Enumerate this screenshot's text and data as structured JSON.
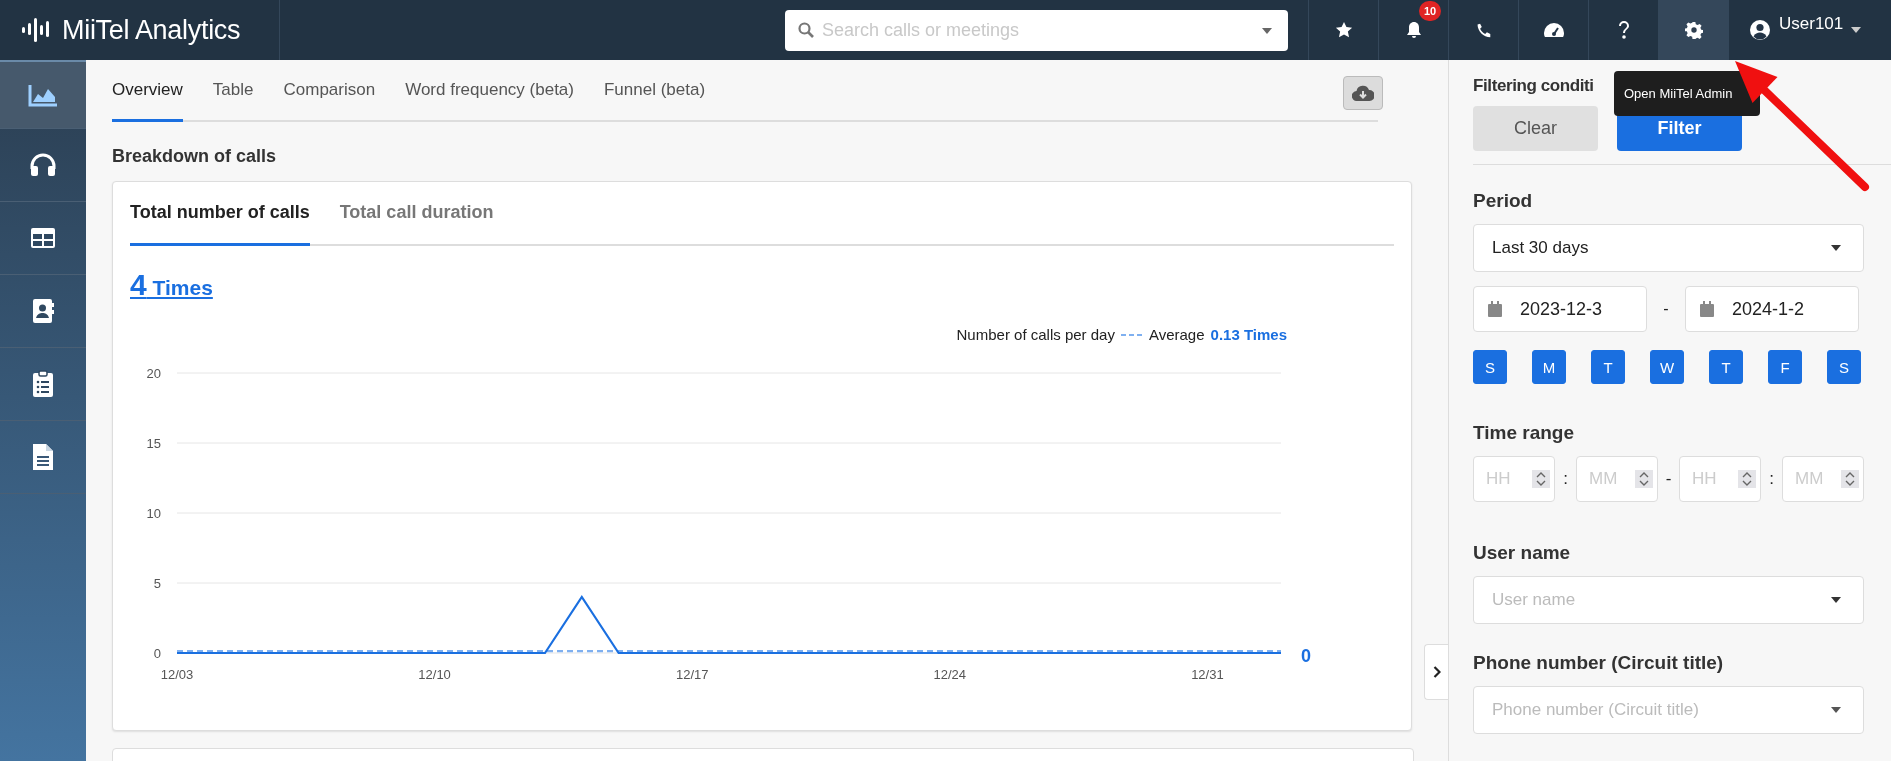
{
  "app": {
    "title": "MiiTel Analytics"
  },
  "search": {
    "placeholder": "Search calls or meetings"
  },
  "toolbar": [
    {
      "kind": "star",
      "selected": false
    },
    {
      "kind": "bell",
      "selected": false,
      "badge": "10"
    },
    {
      "kind": "phone",
      "selected": false
    },
    {
      "kind": "gauge",
      "selected": false
    },
    {
      "kind": "help",
      "selected": false
    },
    {
      "kind": "settings",
      "selected": true
    }
  ],
  "user": {
    "name": "User101"
  },
  "tooltip": {
    "text": "Open MiiTel Admin"
  },
  "sidebar": {
    "items": [
      {
        "kind": "chart",
        "selected": true
      },
      {
        "kind": "headphones",
        "selected": false
      },
      {
        "kind": "table",
        "selected": false
      },
      {
        "kind": "contacts",
        "selected": false
      },
      {
        "kind": "clipboard",
        "selected": false
      },
      {
        "kind": "document",
        "selected": false
      }
    ]
  },
  "tabs": [
    {
      "label": "Overview",
      "selected": true
    },
    {
      "label": "Table",
      "selected": false
    },
    {
      "label": "Comparison",
      "selected": false
    },
    {
      "label": "Word frequency (beta)",
      "selected": false
    },
    {
      "label": "Funnel (beta)",
      "selected": false
    }
  ],
  "section_title": "Breakdown of calls",
  "card": {
    "tabs": [
      {
        "label": "Total number of calls",
        "selected": true
      },
      {
        "label": "Total call duration",
        "selected": false
      }
    ],
    "total": {
      "number": "4",
      "unit": "Times"
    },
    "legend": {
      "average_value": "0.13 Times"
    },
    "end_label": "0",
    "chart_data": {
      "type": "line",
      "categories": [
        "12/03",
        null,
        null,
        null,
        null,
        null,
        null,
        "12/10",
        null,
        null,
        null,
        null,
        null,
        null,
        "12/17",
        null,
        null,
        null,
        null,
        null,
        null,
        "12/24",
        null,
        null,
        null,
        null,
        null,
        null,
        "12/31",
        null,
        null
      ],
      "grid": true,
      "series": [
        {
          "name": "Number of calls per day",
          "color": "#1a6fe0",
          "line_style": "solid",
          "values": [
            0,
            0,
            0,
            0,
            0,
            0,
            0,
            0,
            0,
            0,
            0,
            4,
            0,
            0,
            0,
            0,
            0,
            0,
            0,
            0,
            0,
            0,
            0,
            0,
            0,
            0,
            0,
            0,
            0,
            0,
            0
          ]
        },
        {
          "name": "Average",
          "color": "#7fb0f0",
          "line_style": "dashed",
          "values": [
            0.13,
            0.13,
            0.13,
            0.13,
            0.13,
            0.13,
            0.13,
            0.13,
            0.13,
            0.13,
            0.13,
            0.13,
            0.13,
            0.13,
            0.13,
            0.13,
            0.13,
            0.13,
            0.13,
            0.13,
            0.13,
            0.13,
            0.13,
            0.13,
            0.13,
            0.13,
            0.13,
            0.13,
            0.13,
            0.13,
            0.13
          ]
        }
      ],
      "ylim": [
        0,
        20
      ],
      "yticks": [
        0,
        5,
        10,
        15,
        20
      ]
    }
  },
  "filters": {
    "title": "Filtering conditi",
    "clear": "Clear",
    "filter": "Filter",
    "period": {
      "label": "Period",
      "value": "Last 30 days",
      "start": "2023-12-3",
      "separator": "-",
      "end": "2024-1-2"
    },
    "days": [
      {
        "label": "S",
        "selected": true
      },
      {
        "label": "M",
        "selected": true
      },
      {
        "label": "T",
        "selected": true
      },
      {
        "label": "W",
        "selected": true
      },
      {
        "label": "T",
        "selected": true
      },
      {
        "label": "F",
        "selected": true
      },
      {
        "label": "S",
        "selected": true
      }
    ],
    "time_range": {
      "label": "Time range",
      "fields": [
        {
          "placeholder": "HH"
        },
        {
          "placeholder": "MM"
        },
        {
          "placeholder": "HH"
        },
        {
          "placeholder": "MM"
        }
      ],
      "separators": [
        ":",
        "-",
        ":"
      ]
    },
    "user_name": {
      "label": "User name",
      "placeholder": "User name"
    },
    "phone_number": {
      "label": "Phone number (Circuit title)",
      "placeholder": "Phone number (Circuit title)"
    }
  }
}
